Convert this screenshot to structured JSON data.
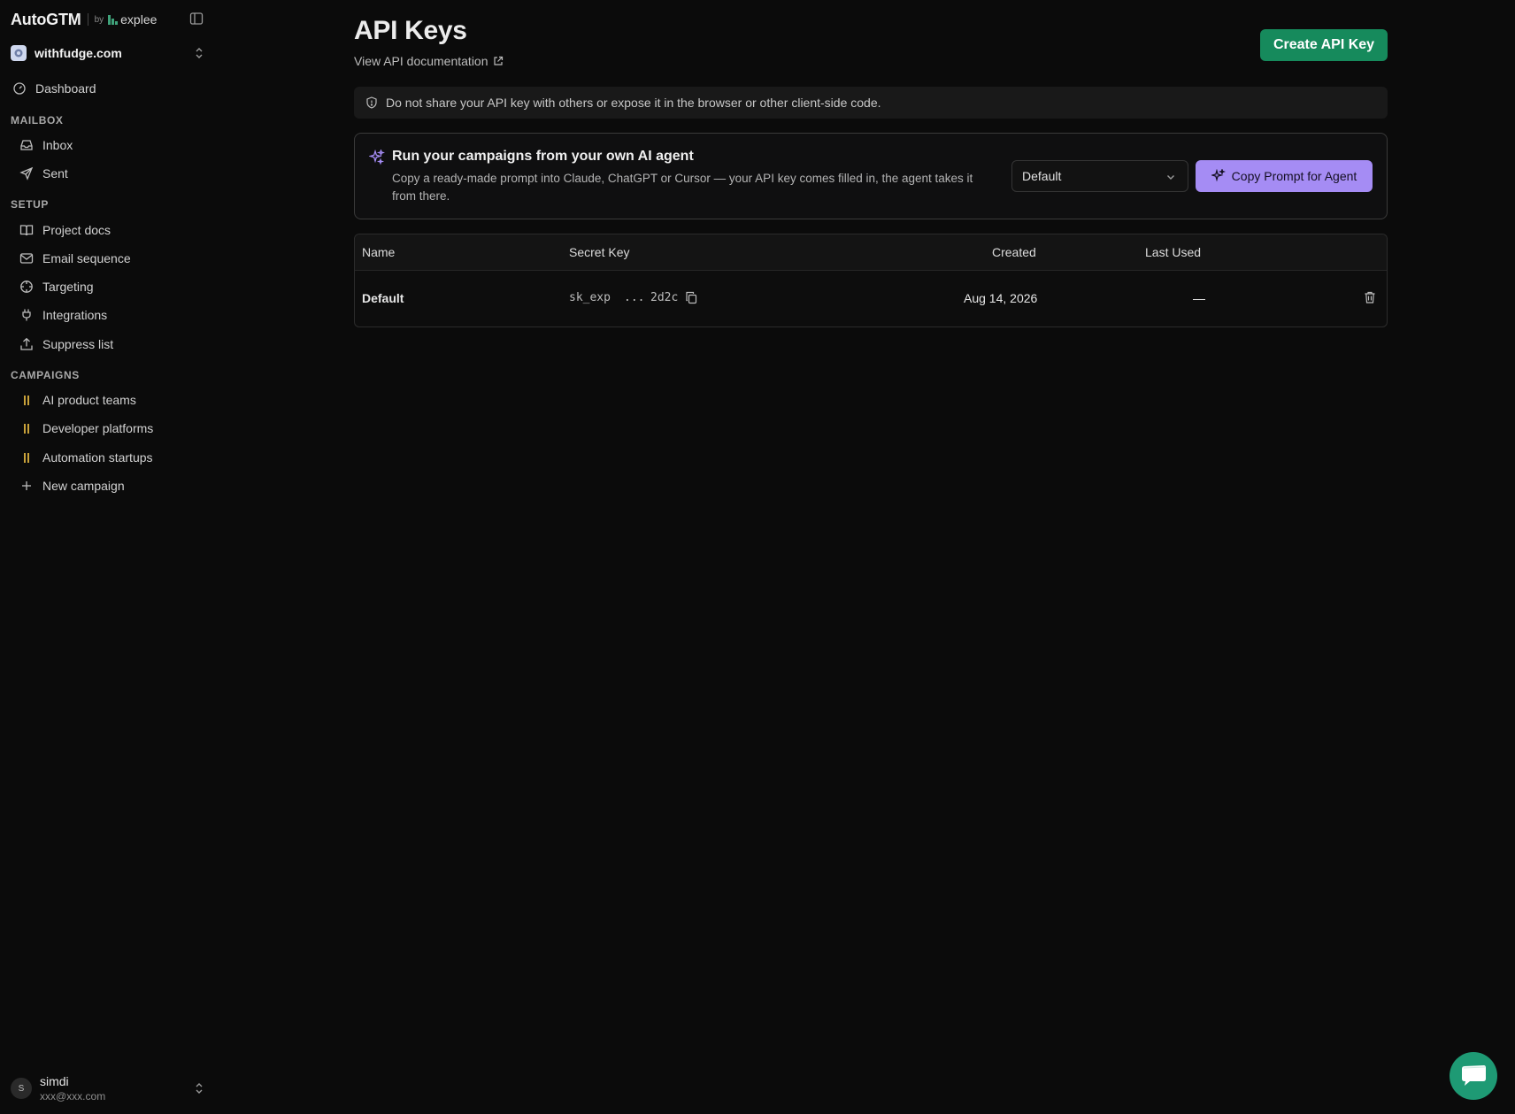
{
  "app": {
    "brand": "AutoGTM",
    "by": "by",
    "partner": "explee",
    "workspace": "withfudge.com"
  },
  "sidebar": {
    "dashboard": "Dashboard",
    "sections": {
      "mailbox": "MAILBOX",
      "setup": "SETUP",
      "campaigns": "CAMPAIGNS"
    },
    "mailbox_items": [
      "Inbox",
      "Sent"
    ],
    "setup_items": [
      "Project docs",
      "Email sequence",
      "Targeting",
      "Integrations",
      "Suppress list"
    ],
    "campaign_items": [
      "AI product teams",
      "Developer platforms",
      "Automation startups"
    ],
    "new_campaign": "New campaign",
    "user": {
      "initial": "S",
      "name": "simdi",
      "email": "xxx@xxx.com"
    }
  },
  "page": {
    "title": "API Keys",
    "doc_link": "View API documentation",
    "create_button": "Create API Key",
    "warning": "Do not share your API key with others or expose it in the browser or other client-side code."
  },
  "agent_card": {
    "title": "Run your campaigns from your own AI agent",
    "description": "Copy a ready-made prompt into Claude, ChatGPT or Cursor — your API key comes filled in, the agent takes it from there.",
    "select_value": "Default",
    "copy_button": "Copy Prompt for Agent"
  },
  "table": {
    "headers": [
      "Name",
      "Secret Key",
      "Created",
      "Last Used"
    ],
    "rows": [
      {
        "name": "Default",
        "key_prefix": "sk_exp",
        "key_ellipsis": "...",
        "key_suffix": "2d2c",
        "created": "Aug 14, 2026",
        "last_used": "—"
      }
    ]
  },
  "colors": {
    "background": "#0b0b0b",
    "primary_green": "#168a5c",
    "agent_purple": "#a58cf4",
    "campaign_icon": "#c9a23a",
    "chat_fab": "#1e9a74"
  },
  "icons": {
    "dashboard": "gauge-icon",
    "inbox": "inbox-icon",
    "sent": "send-icon",
    "project_docs": "book-icon",
    "email_sequence": "mail-icon",
    "targeting": "crosshair-icon",
    "integrations": "plug-icon",
    "suppress_list": "upload-icon",
    "campaign": "pause-icon",
    "new_campaign": "plus-icon",
    "warning": "shield-icon",
    "agent": "sparkles-icon",
    "copy": "copy-icon",
    "delete": "trash-icon",
    "chat": "chat-icon"
  }
}
